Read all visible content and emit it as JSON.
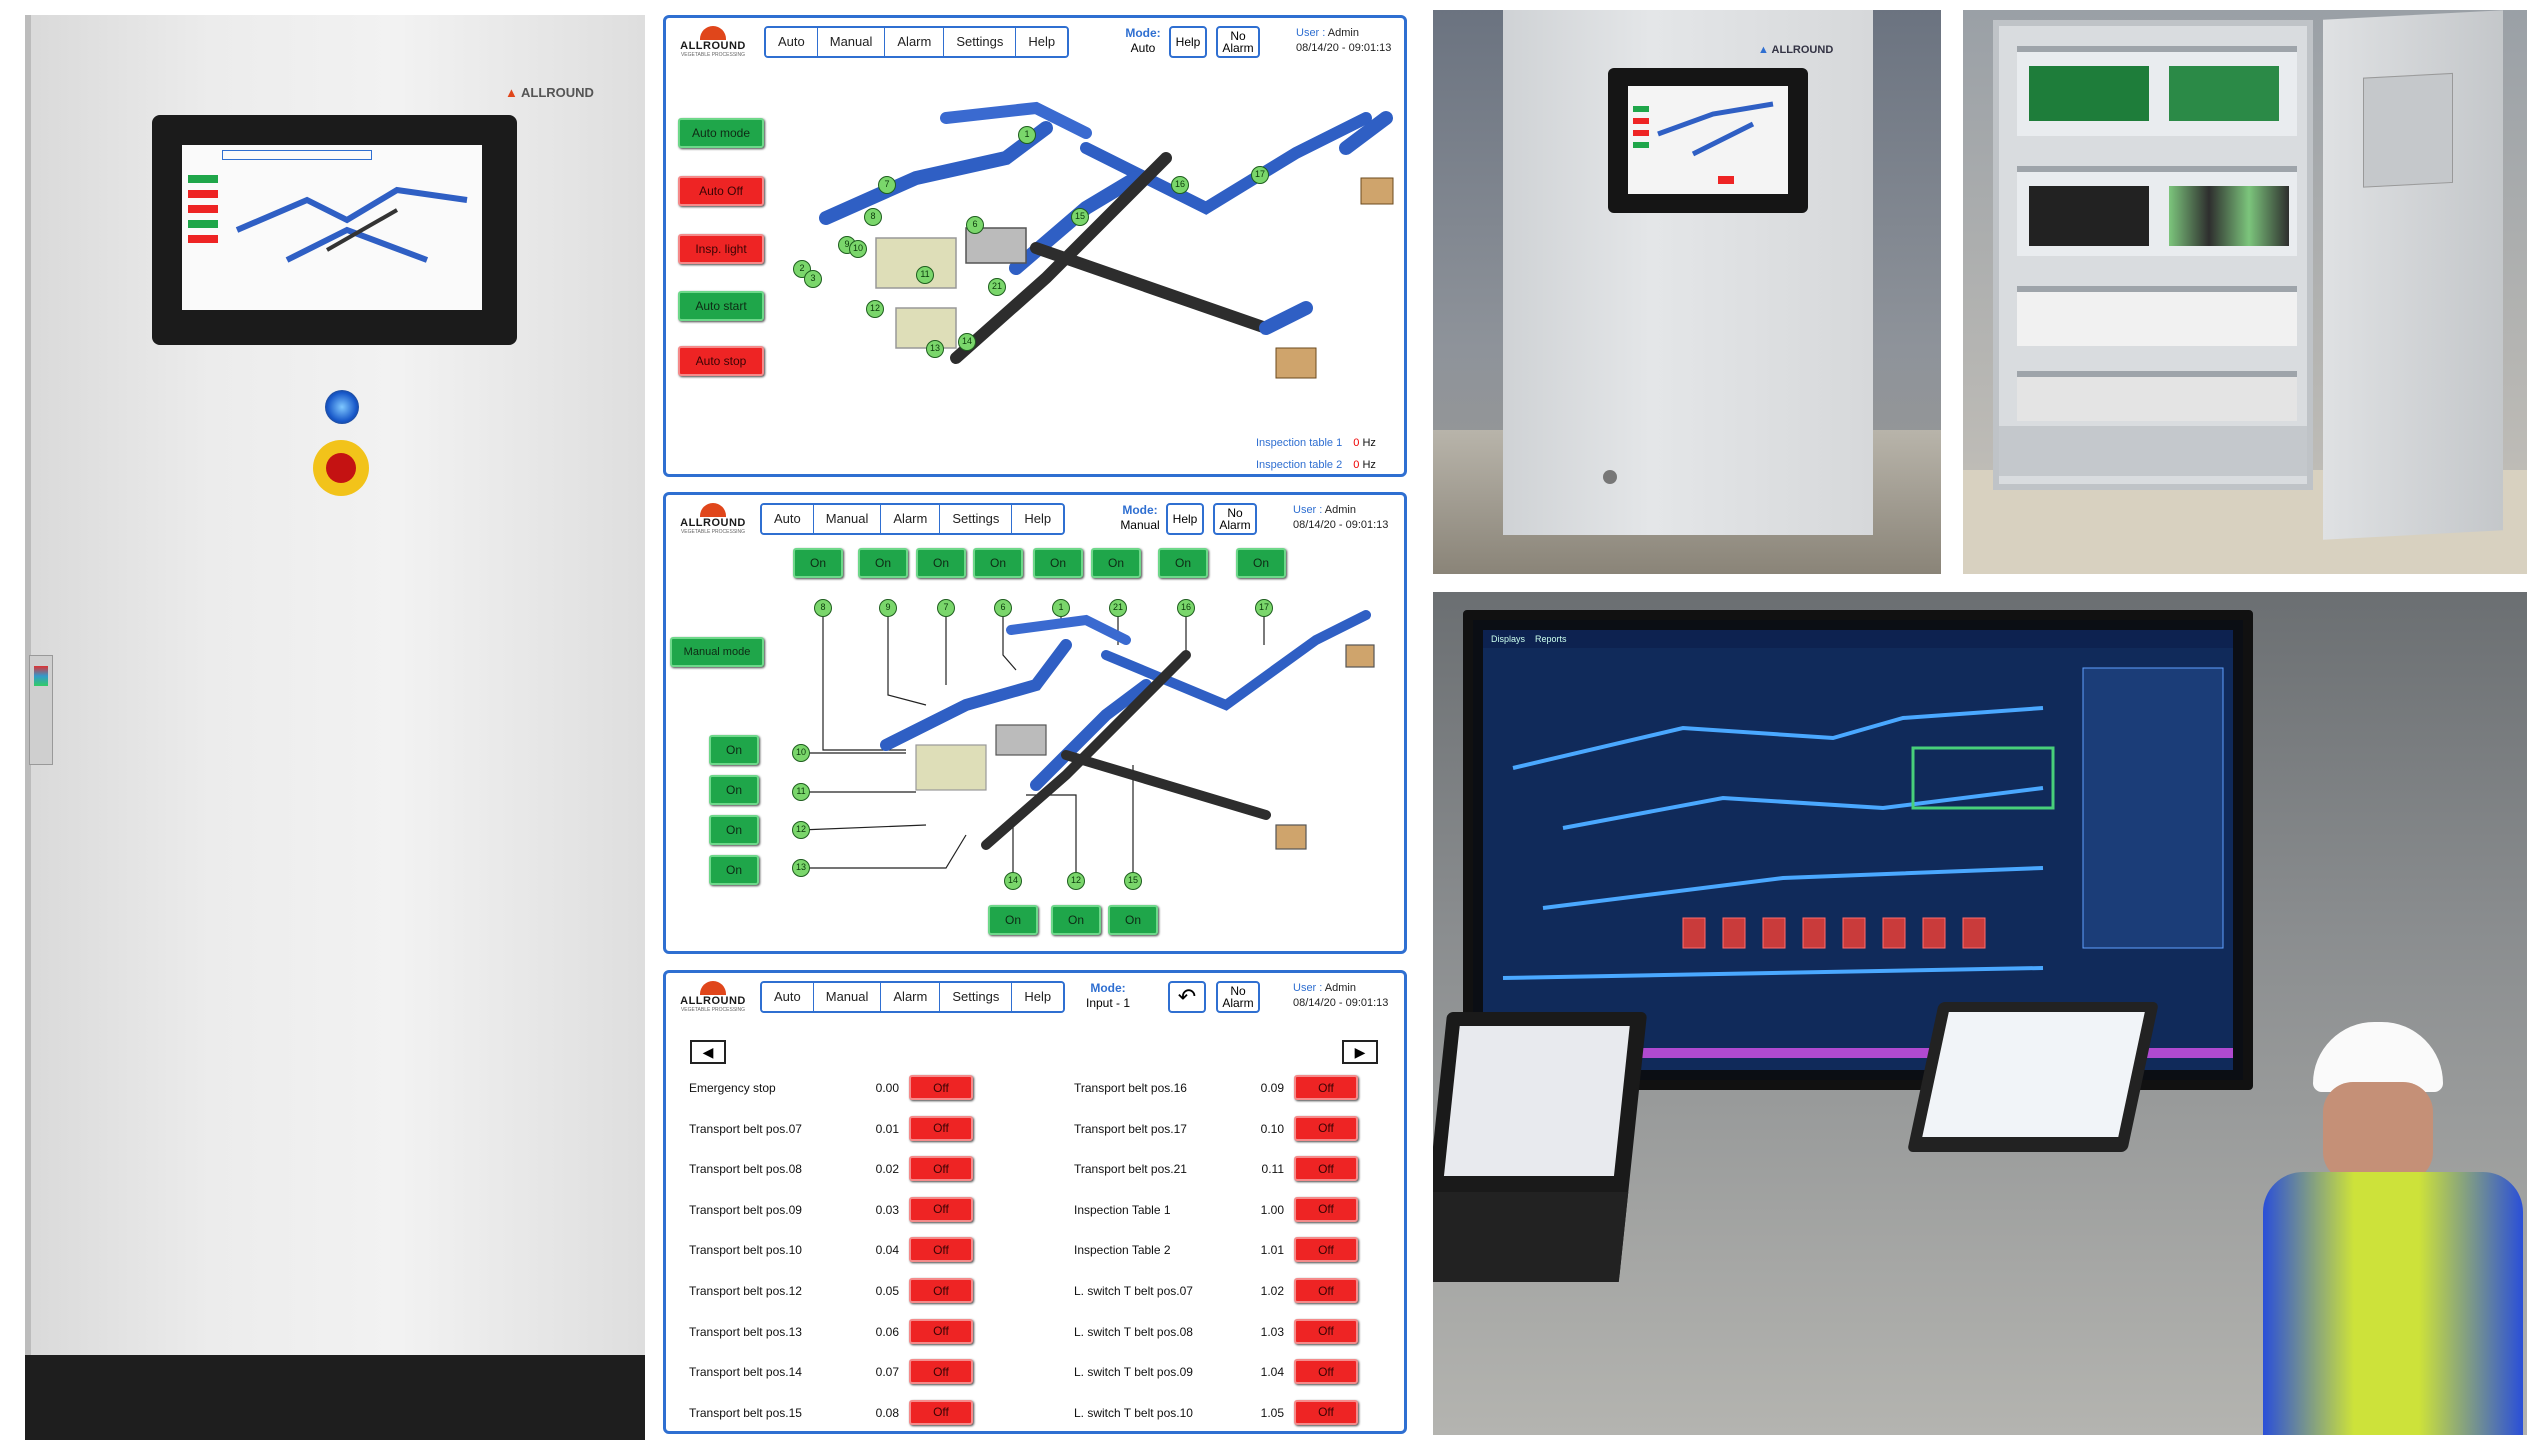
{
  "app": {
    "brand": "ALLROUND",
    "brand_sub": "VEGETABLE PROCESSING"
  },
  "nav": [
    "Auto",
    "Manual",
    "Alarm",
    "Settings",
    "Help"
  ],
  "common": {
    "help_label": "Help",
    "alarm_label": "No\nAlarm",
    "user_label": "User :",
    "user_name": "Admin",
    "datetime": "08/14/20 - 09:01:13",
    "mode_label": "Mode:"
  },
  "auto_screen": {
    "mode_value": "Auto",
    "buttons": [
      {
        "label": "Auto mode",
        "color": "green"
      },
      {
        "label": "Auto Off",
        "color": "red"
      },
      {
        "label": "Insp. light",
        "color": "red"
      },
      {
        "label": "Auto start",
        "color": "green"
      },
      {
        "label": "Auto stop",
        "color": "red"
      }
    ],
    "stations": [
      "1",
      "7",
      "8",
      "6",
      "9",
      "10",
      "11",
      "2",
      "3",
      "12",
      "13",
      "14",
      "21",
      "15",
      "16",
      "17"
    ],
    "readouts": [
      {
        "label": "Inspection table 1",
        "value": "0",
        "unit": "Hz"
      },
      {
        "label": "Inspection table 2",
        "value": "0",
        "unit": "Hz"
      }
    ]
  },
  "manual_screen": {
    "mode_value": "Manual",
    "mode_button": "Manual mode",
    "on_label": "On",
    "top_stations": [
      "8",
      "9",
      "7",
      "6",
      "1",
      "21",
      "16",
      "17"
    ],
    "left_stations": [
      "10",
      "11",
      "12",
      "13"
    ],
    "bottom_stations": [
      "14",
      "12",
      "15"
    ]
  },
  "input_screen": {
    "mode_value": "Input - 1",
    "prev_icon": "◀",
    "next_icon": "▶",
    "back_icon": "↶",
    "off_label": "Off",
    "left_rows": [
      {
        "label": "Emergency stop",
        "value": "0.00"
      },
      {
        "label": "Transport belt pos.07",
        "value": "0.01"
      },
      {
        "label": "Transport belt pos.08",
        "value": "0.02"
      },
      {
        "label": "Transport belt pos.09",
        "value": "0.03"
      },
      {
        "label": "Transport belt pos.10",
        "value": "0.04"
      },
      {
        "label": "Transport belt pos.12",
        "value": "0.05"
      },
      {
        "label": "Transport belt pos.13",
        "value": "0.06"
      },
      {
        "label": "Transport belt pos.14",
        "value": "0.07"
      },
      {
        "label": "Transport belt pos.15",
        "value": "0.08"
      }
    ],
    "right_rows": [
      {
        "label": "Transport belt pos.16",
        "value": "0.09"
      },
      {
        "label": "Transport belt pos.17",
        "value": "0.10"
      },
      {
        "label": "Transport belt pos.21",
        "value": "0.11"
      },
      {
        "label": "Inspection Table 1",
        "value": "1.00"
      },
      {
        "label": "Inspection Table 2",
        "value": "1.01"
      },
      {
        "label": "L. switch T belt pos.07",
        "value": "1.02"
      },
      {
        "label": "L. switch T belt pos.08",
        "value": "1.03"
      },
      {
        "label": "L. switch T belt pos.09",
        "value": "1.04"
      },
      {
        "label": "L. switch T belt pos.10",
        "value": "1.05"
      }
    ]
  },
  "photos": {
    "cabinet_brand": "ALLROUND",
    "scada_tabs": [
      "Displays",
      "Reports"
    ]
  },
  "colors": {
    "accent": "#2f6fd1",
    "on": "#1fa64a",
    "off": "#ee2424"
  }
}
